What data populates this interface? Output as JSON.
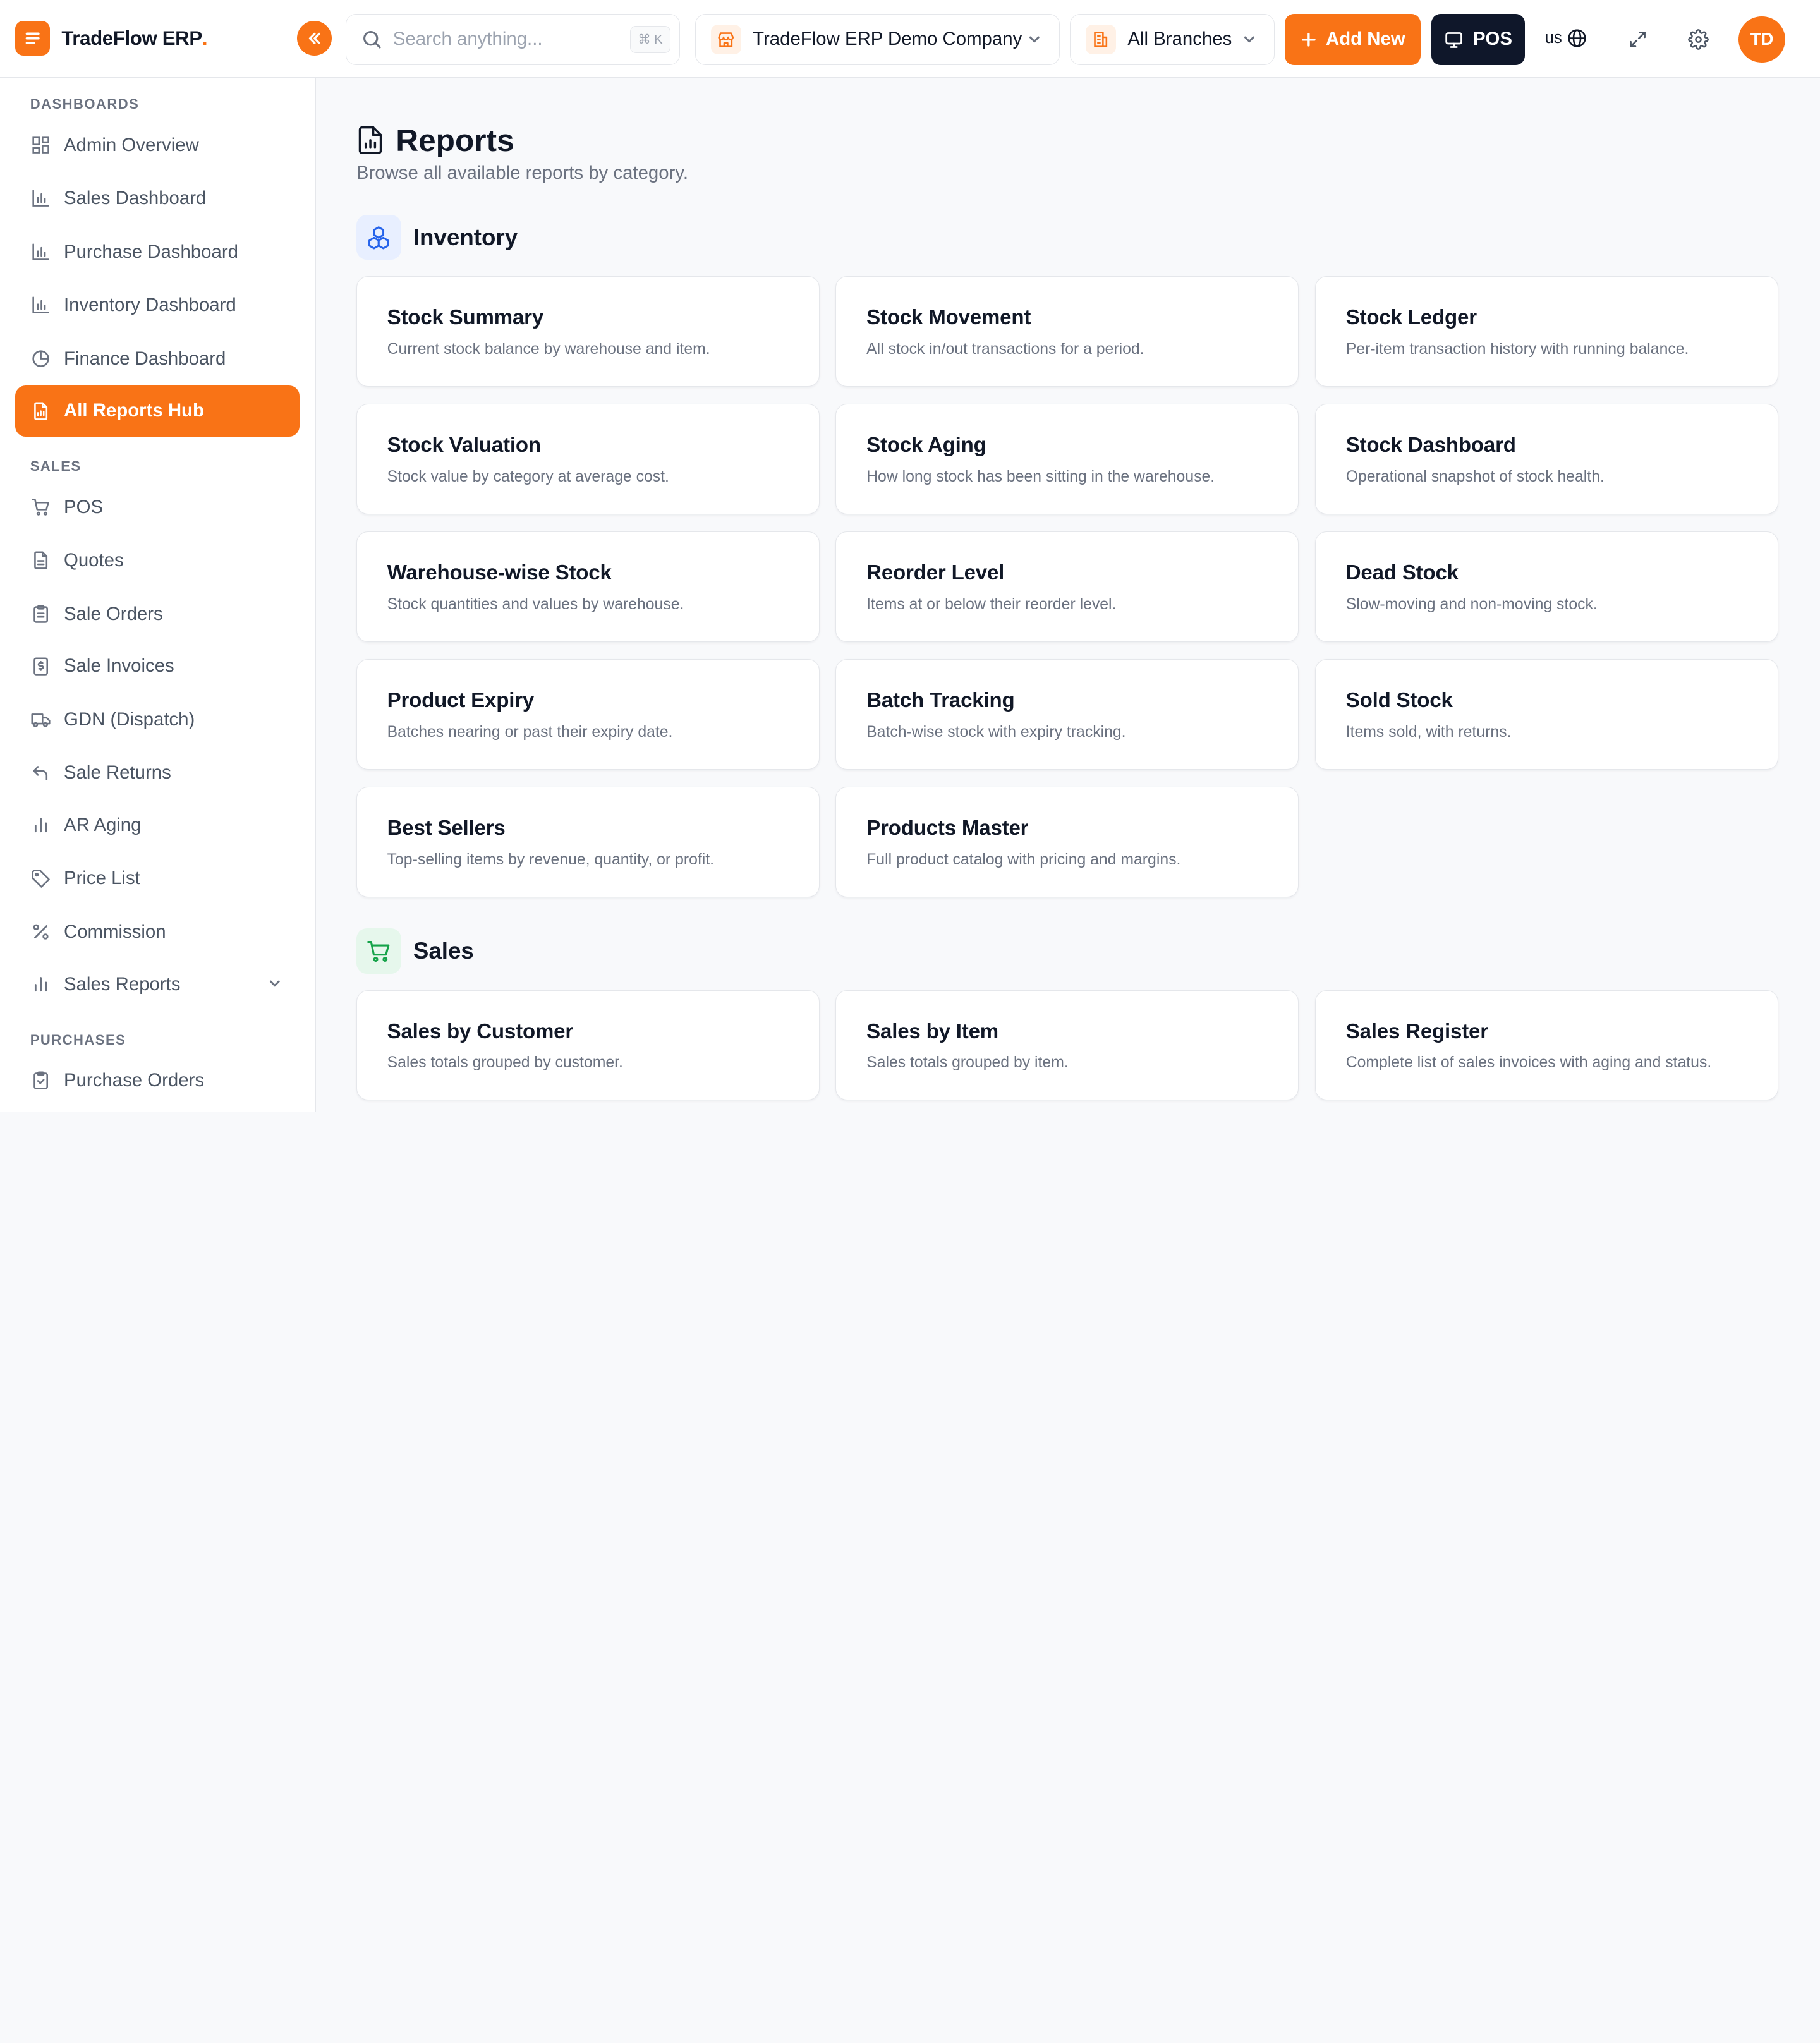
{
  "app": {
    "name": "TradeFlow ERP",
    "dot": "."
  },
  "header": {
    "search_placeholder": "Search anything...",
    "search_shortcut": "⌘ K",
    "company": "TradeFlow ERP Demo Company",
    "branches": "All Branches",
    "add_new": "Add New",
    "pos": "POS",
    "language": "us",
    "avatar_initials": "TD"
  },
  "sidebar": {
    "sections": [
      {
        "label": "DASHBOARDS"
      },
      {
        "label": "SALES"
      },
      {
        "label": "PURCHASES"
      }
    ],
    "items": [
      {
        "label": "Admin Overview",
        "icon": "grid-icon"
      },
      {
        "label": "Sales Dashboard",
        "icon": "bar-chart-icon"
      },
      {
        "label": "Purchase Dashboard",
        "icon": "bar-chart-icon"
      },
      {
        "label": "Inventory Dashboard",
        "icon": "bar-chart-icon"
      },
      {
        "label": "Finance Dashboard",
        "icon": "pie-chart-icon"
      },
      {
        "label": "All Reports Hub",
        "icon": "report-icon",
        "active": true
      },
      {
        "label": "POS",
        "icon": "cart-icon"
      },
      {
        "label": "Quotes",
        "icon": "document-icon"
      },
      {
        "label": "Sale Orders",
        "icon": "clipboard-icon"
      },
      {
        "label": "Sale Invoices",
        "icon": "invoice-icon"
      },
      {
        "label": "GDN (Dispatch)",
        "icon": "truck-icon"
      },
      {
        "label": "Sale Returns",
        "icon": "return-icon"
      },
      {
        "label": "AR Aging",
        "icon": "bar-chart-icon"
      },
      {
        "label": "Price List",
        "icon": "tag-icon"
      },
      {
        "label": "Commission",
        "icon": "percent-icon"
      },
      {
        "label": "Sales Reports",
        "icon": "bar-chart-icon"
      },
      {
        "label": "Purchase Orders",
        "icon": "clipboard-icon"
      }
    ]
  },
  "page": {
    "title": "Reports",
    "subtitle": "Browse all available reports by category."
  },
  "categories": [
    {
      "title": "Inventory",
      "color": "#2563eb",
      "bg": "#e8efff",
      "reports": [
        {
          "title": "Stock Summary",
          "desc": "Current stock balance by warehouse and item."
        },
        {
          "title": "Stock Movement",
          "desc": "All stock in/out transactions for a period."
        },
        {
          "title": "Stock Ledger",
          "desc": "Per-item transaction history with running balance."
        },
        {
          "title": "Stock Valuation",
          "desc": "Stock value by category at average cost."
        },
        {
          "title": "Stock Aging",
          "desc": "How long stock has been sitting in the warehouse."
        },
        {
          "title": "Stock Dashboard",
          "desc": "Operational snapshot of stock health."
        },
        {
          "title": "Warehouse-wise Stock",
          "desc": "Stock quantities and values by warehouse."
        },
        {
          "title": "Reorder Level",
          "desc": "Items at or below their reorder level."
        },
        {
          "title": "Dead Stock",
          "desc": "Slow-moving and non-moving stock."
        },
        {
          "title": "Product Expiry",
          "desc": "Batches nearing or past their expiry date."
        },
        {
          "title": "Batch Tracking",
          "desc": "Batch-wise stock with expiry tracking."
        },
        {
          "title": "Sold Stock",
          "desc": "Items sold, with returns."
        },
        {
          "title": "Best Sellers",
          "desc": "Top-selling items by revenue, quantity, or profit."
        },
        {
          "title": "Products Master",
          "desc": "Full product catalog with pricing and margins."
        }
      ]
    },
    {
      "title": "Sales",
      "color": "#16a34a",
      "bg": "#e6f7ec",
      "reports": [
        {
          "title": "Sales by Customer",
          "desc": "Sales totals grouped by customer."
        },
        {
          "title": "Sales by Item",
          "desc": "Sales totals grouped by item."
        },
        {
          "title": "Sales Register",
          "desc": "Complete list of sales invoices with aging and status."
        }
      ]
    }
  ],
  "colors": {
    "accent": "#f97316",
    "dark": "#0f172a"
  }
}
